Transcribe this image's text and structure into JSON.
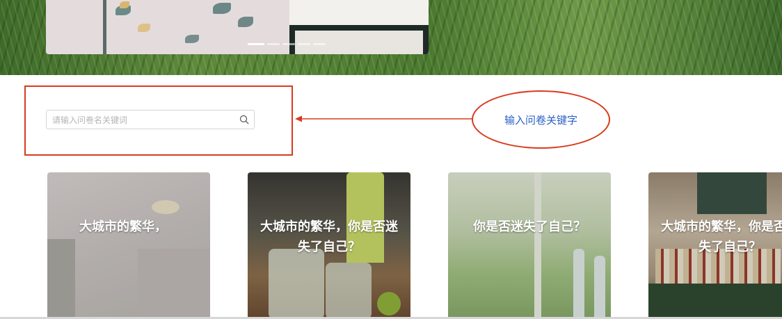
{
  "banner": {
    "carousel_slide_count": 5,
    "carousel_active_index": 0
  },
  "search": {
    "placeholder": "请输入问卷名关键词",
    "value": ""
  },
  "annotation": {
    "callout_text": "输入问卷关键字",
    "color": "#d93a1e"
  },
  "cards": [
    {
      "title": "大城市的繁华，"
    },
    {
      "title": "大城市的繁华，你是否迷失了自己？"
    },
    {
      "title": "你是否迷失了自己？"
    },
    {
      "title": "大城市的繁华，你是否迷失了自己？"
    }
  ],
  "colors": {
    "accent_blue": "#2b61c8",
    "annotation_red": "#d93a1e"
  }
}
